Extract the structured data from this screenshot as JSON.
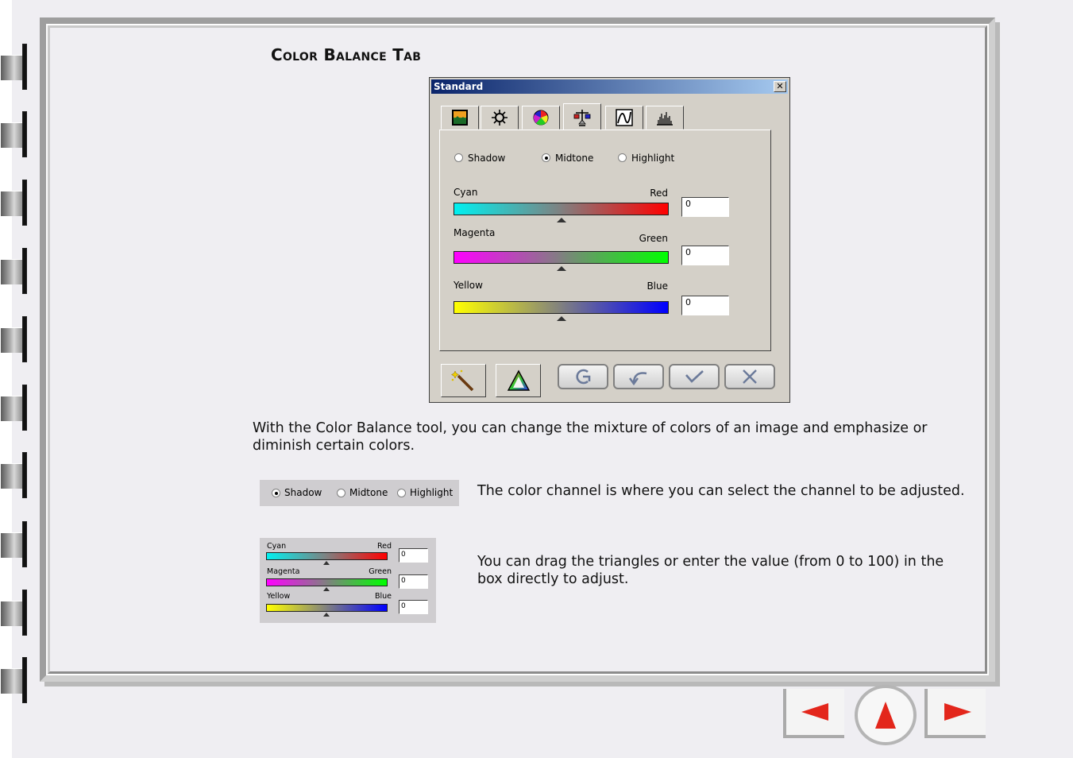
{
  "page": {
    "title": "Color Balance Tab",
    "intro": "With the Color Balance tool, you can change the mixture of colors of an image and emphasize or diminish certain colors.",
    "channel_desc": "The color channel is where you can select the channel to be adjusted.",
    "slider_desc": "You can drag the triangles or enter the value (from 0 to 100) in the box directly to adjust."
  },
  "dialog": {
    "title": "Standard",
    "close_label": "✕",
    "radios": [
      {
        "label": "Shadow",
        "checked": false
      },
      {
        "label": "Midtone",
        "checked": true
      },
      {
        "label": "Highlight",
        "checked": false
      }
    ],
    "sliders": [
      {
        "left": "Cyan",
        "right": "Red",
        "value": "0",
        "left_color": "#00f0f0",
        "right_color": "#ff0000"
      },
      {
        "left": "Magenta",
        "right": "Green",
        "value": "0",
        "left_color": "#ff00ff",
        "right_color": "#00ff00"
      },
      {
        "left": "Yellow",
        "right": "Blue",
        "value": "0",
        "left_color": "#ffff00",
        "right_color": "#0000ff"
      }
    ]
  },
  "channel_example": {
    "radios": [
      {
        "label": "Shadow",
        "checked": true
      },
      {
        "label": "Midtone",
        "checked": false
      },
      {
        "label": "Highlight",
        "checked": false
      }
    ]
  },
  "slider_example": {
    "sliders": [
      {
        "left": "Cyan",
        "right": "Red",
        "value": "0"
      },
      {
        "left": "Magenta",
        "right": "Green",
        "value": "0"
      },
      {
        "left": "Yellow",
        "right": "Blue",
        "value": "0"
      }
    ]
  },
  "colors": {
    "nav_arrow": "#e3261b",
    "title_bar_start": "#0a246a",
    "title_bar_end": "#a6caf0"
  }
}
